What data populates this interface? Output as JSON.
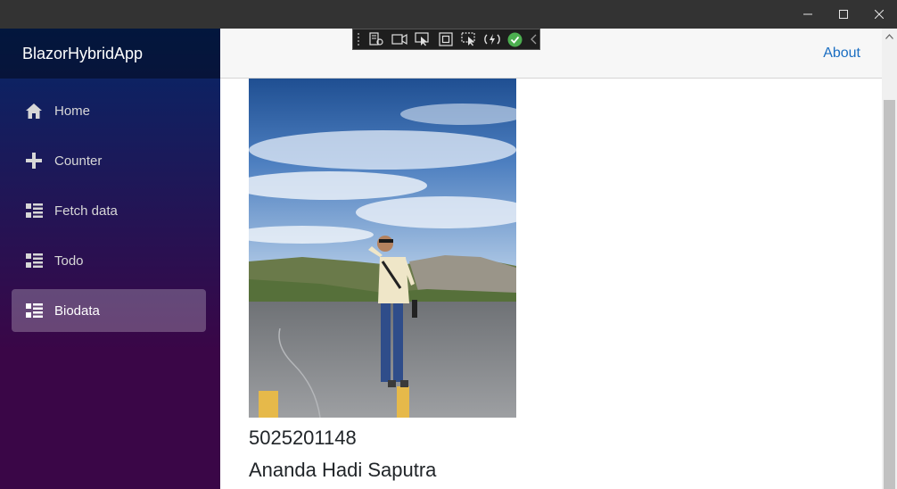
{
  "window": {
    "minimize_icon": "minimize-icon",
    "maximize_icon": "maximize-icon",
    "close_icon": "close-icon"
  },
  "sidebar": {
    "brand": "BlazorHybridApp",
    "items": [
      {
        "label": "Home",
        "icon": "home-icon",
        "active": false
      },
      {
        "label": "Counter",
        "icon": "plus-icon",
        "active": false
      },
      {
        "label": "Fetch data",
        "icon": "list-icon",
        "active": false
      },
      {
        "label": "Todo",
        "icon": "list-icon",
        "active": false
      },
      {
        "label": "Biodata",
        "icon": "list-icon",
        "active": true
      }
    ]
  },
  "top_row": {
    "about_link": "About"
  },
  "debug_toolbar": {
    "icons": [
      "live-visual-tree-icon",
      "record-icon",
      "select-element-icon",
      "display-layout-adorners-icon",
      "track-focus-icon",
      "hot-reload-icon",
      "binding-check-icon",
      "collapse-chevron-icon"
    ]
  },
  "biodata": {
    "nrp": "5025201148",
    "name": "Ananda Hadi Saputra",
    "photo": "person-on-volcano-photo"
  },
  "colors": {
    "sidebar_top": "#052767",
    "sidebar_bottom": "#3a0647",
    "link": "#1b6ec2",
    "titlebar": "#333333"
  }
}
